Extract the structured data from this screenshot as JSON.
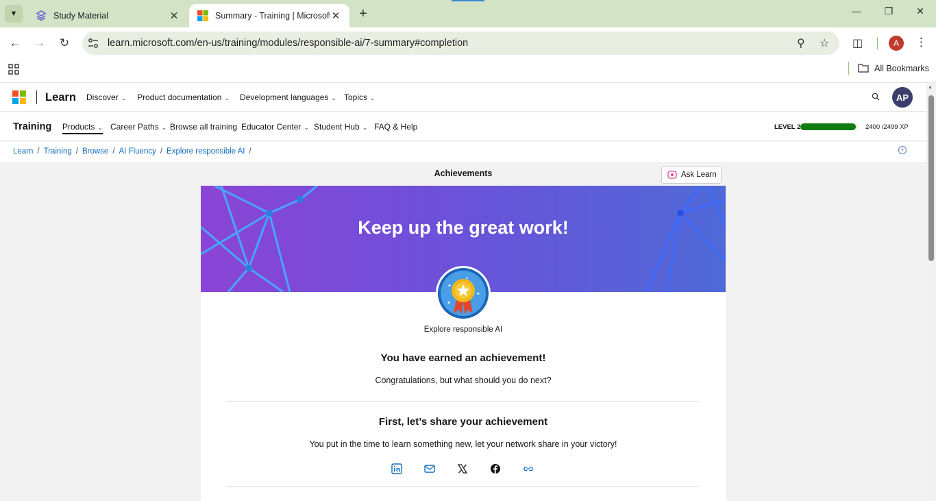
{
  "browser": {
    "tabs": [
      {
        "title": "Study Material",
        "active": false
      },
      {
        "title": "Summary - Training | Microsoft",
        "active": true
      }
    ],
    "url": "learn.microsoft.com/en-us/training/modules/responsible-ai/7-summary#completion",
    "bookmarks_label": "All Bookmarks",
    "profile_initial": "A"
  },
  "site": {
    "brand": "Learn",
    "top_nav": [
      "Discover",
      "Product documentation",
      "Development languages",
      "Topics"
    ],
    "avatar_initials": "AP",
    "section_title": "Training",
    "sub_nav": [
      "Products",
      "Career Paths",
      "Browse all training",
      "Educator Center",
      "Student Hub",
      "FAQ & Help"
    ],
    "level_label": "LEVEL 2",
    "xp_text": "2400 /2499 XP",
    "xp_progress": 0.96,
    "breadcrumbs": [
      "Learn",
      "Training",
      "Browse",
      "AI Fluency",
      "Explore responsible AI"
    ]
  },
  "main": {
    "page_title": "Achievements",
    "ask_learn": "Ask Learn",
    "banner_text": "Keep up the great work!",
    "badge_name": "Explore responsible AI",
    "earned_heading": "You have earned an achievement!",
    "congrats_text": "Congratulations, but what should you do next?",
    "share_heading": "First, let’s share your achievement",
    "share_text": "You put in the time to learn something new, let your network share in your victory!",
    "share_icons": [
      "linkedin-icon",
      "email-icon",
      "x-icon",
      "facebook-icon",
      "link-icon"
    ]
  },
  "colors": {
    "link": "#0f6cbd",
    "xp_fill": "#107c10",
    "banner_start": "#8a44d6",
    "banner_end": "#4f6ad8"
  }
}
